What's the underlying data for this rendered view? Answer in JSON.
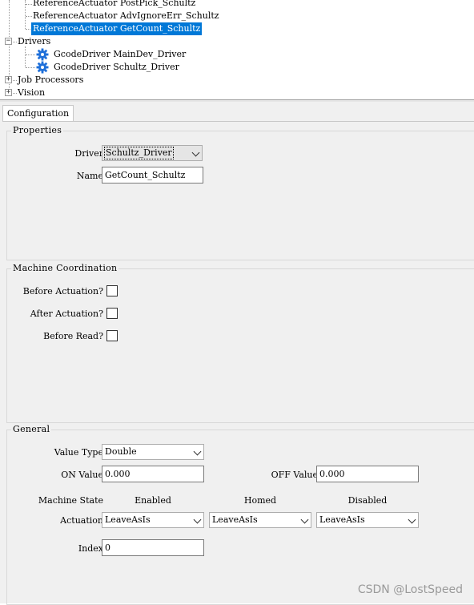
{
  "tree": {
    "items": [
      {
        "label": "ReferenceActuator PostPick_Schultz",
        "selected": false
      },
      {
        "label": "ReferenceActuator AdvIgnoreErr_Schultz",
        "selected": false
      },
      {
        "label": "ReferenceActuator GetCount_Schultz",
        "selected": true
      }
    ],
    "drivers": {
      "label": "Drivers",
      "expander": "−",
      "children": [
        {
          "label": "GcodeDriver MainDev_Driver",
          "icon": "gear-icon"
        },
        {
          "label": "GcodeDriver Schultz_Driver",
          "icon": "gear-icon"
        }
      ]
    },
    "job_processors": {
      "label": "Job Processors",
      "expander": "+"
    },
    "vision": {
      "label": "Vision",
      "expander": "+"
    }
  },
  "tabs": [
    {
      "label": "Configuration",
      "active": true
    }
  ],
  "properties": {
    "title": "Properties",
    "driver_label": "Driver",
    "driver_value": "Schultz_Driver",
    "name_label": "Name",
    "name_value": "GetCount_Schultz"
  },
  "machine_coordination": {
    "title": "Machine Coordination",
    "before_actuation_label": "Before Actuation?",
    "before_actuation_checked": false,
    "after_actuation_label": "After Actuation?",
    "after_actuation_checked": false,
    "before_read_label": "Before Read?",
    "before_read_checked": false
  },
  "general": {
    "title": "General",
    "value_type_label": "Value Type",
    "value_type_value": "Double",
    "on_value_label": "ON Value",
    "on_value": "0.000",
    "off_value_label": "OFF Value",
    "off_value": "0.000",
    "machine_state_label": "Machine State",
    "col_enabled": "Enabled",
    "col_homed": "Homed",
    "col_disabled": "Disabled",
    "actuation_label": "Actuation",
    "actuation_enabled": "LeaveAsIs",
    "actuation_homed": "LeaveAsIs",
    "actuation_disabled": "LeaveAsIs",
    "index_label": "Index",
    "index_value": "0"
  },
  "watermark": "CSDN @LostSpeed",
  "colors": {
    "selection": "#0078d7",
    "panel_bg": "#f0f0f0",
    "gear": "#1e6fd9"
  }
}
